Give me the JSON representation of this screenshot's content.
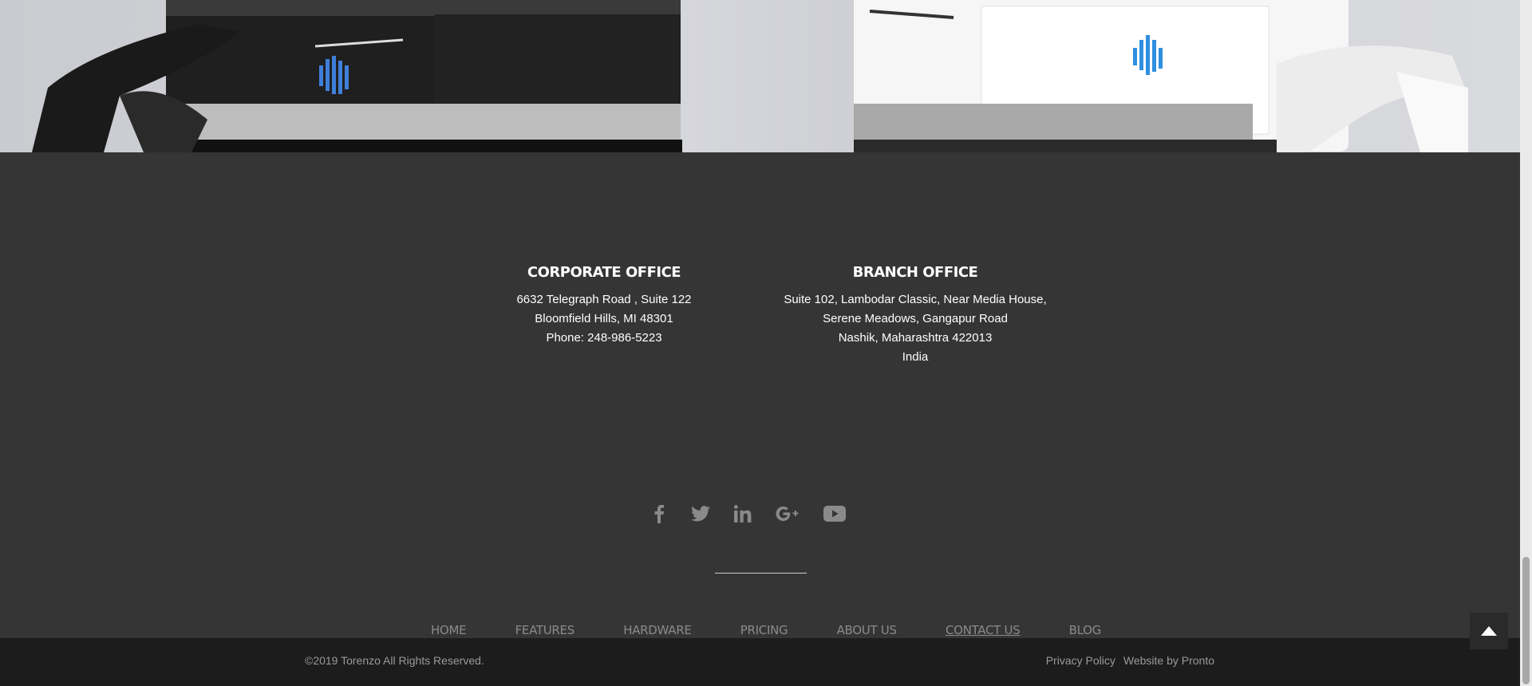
{
  "offices": {
    "corporate": {
      "title": "CORPORATE OFFICE",
      "lines": [
        "6632 Telegraph Road , Suite 122",
        "Bloomfield Hills, MI 48301",
        "Phone: 248-986-5223"
      ]
    },
    "branch": {
      "title": "BRANCH OFFICE",
      "lines": [
        "Suite 102, Lambodar Classic, Near Media House,",
        "Serene Meadows, Gangapur Road",
        "Nashik, Maharashtra 422013",
        "India"
      ]
    }
  },
  "social": [
    "facebook-icon",
    "twitter-icon",
    "linkedin-icon",
    "google-plus-icon",
    "youtube-icon"
  ],
  "nav": {
    "items": [
      "HOME",
      "FEATURES",
      "HARDWARE",
      "PRICING",
      "ABOUT US",
      "CONTACT US",
      "BLOG"
    ],
    "active_index": 5
  },
  "bottom": {
    "copyright": "©2019 Torenzo All Rights Reserved.",
    "privacy": "Privacy Policy",
    "credit": "Website by Pronto"
  },
  "colors": {
    "footer_bg": "#353535",
    "bottom_bg": "#1c1c1c",
    "icon_gray": "#8a8a8a"
  }
}
